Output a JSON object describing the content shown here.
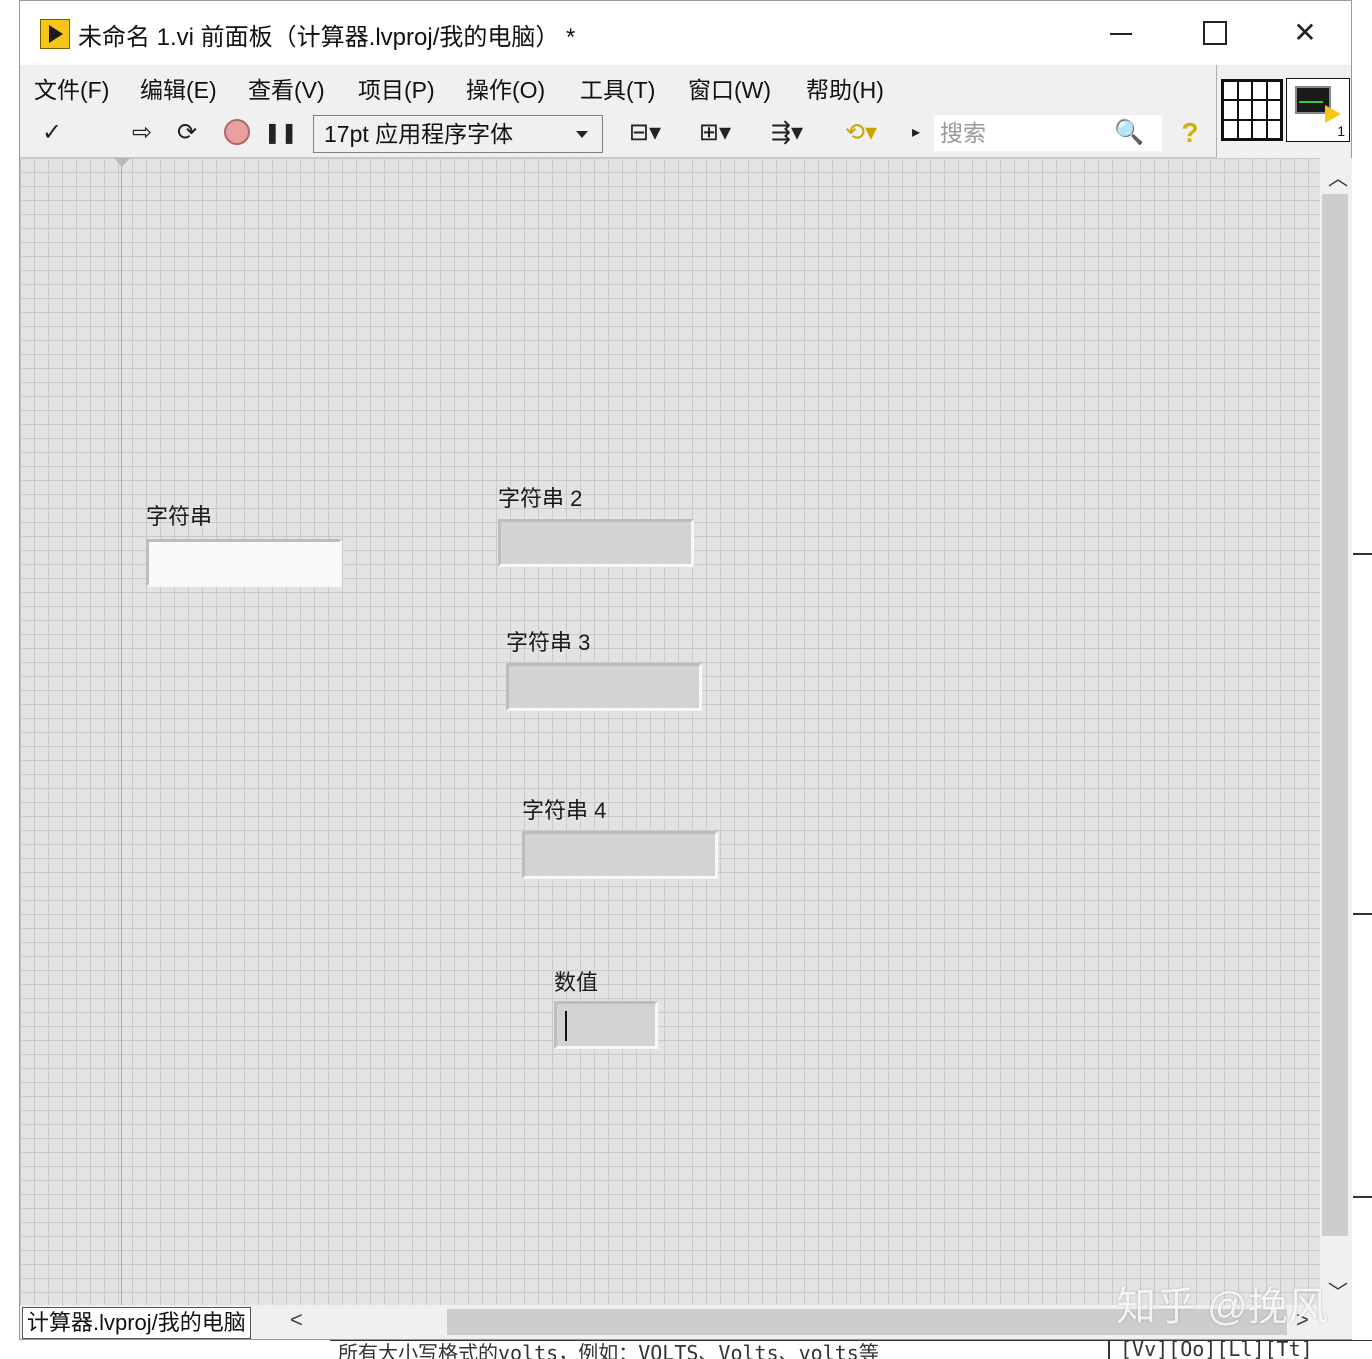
{
  "window": {
    "title": "未命名 1.vi 前面板（计算器.lvproj/我的电脑） *",
    "close_glyph": "✕"
  },
  "menu": {
    "items": [
      "文件(F)",
      "编辑(E)",
      "查看(V)",
      "项目(P)",
      "操作(O)",
      "工具(T)",
      "窗口(W)",
      "帮助(H)"
    ]
  },
  "toolbar": {
    "check_glyph": "✓",
    "run_glyph": "⇨",
    "run_continuous_glyph": "⟳",
    "pause_glyph": "❚❚",
    "font": "17pt 应用程序字体",
    "search_placeholder": "搜索",
    "search_icon_glyph": "🔍",
    "help_glyph": "?",
    "align_glyph": "⊟▾",
    "distribute_glyph": "⊞▾",
    "resize_glyph": "⇶▾",
    "reorder_glyph": "⟲▾",
    "expand_glyph": "▸"
  },
  "front_panel": {
    "controls": [
      {
        "label": "字符串",
        "type": "string-control"
      },
      {
        "label": "字符串 2",
        "type": "string-indicator"
      },
      {
        "label": "字符串 3",
        "type": "string-indicator"
      },
      {
        "label": "字符串 4",
        "type": "string-indicator"
      },
      {
        "label": "数值",
        "type": "numeric-indicator"
      }
    ]
  },
  "vi_icon": {
    "number": "1"
  },
  "scroll": {
    "up_glyph": "︿",
    "down_glyph": "﹀",
    "left_glyph": "<",
    "right_glyph": ">"
  },
  "status": {
    "project": "计算器.lvproj/我的电脑"
  },
  "watermark": "知乎 @挽风",
  "background_text": {
    "bottom": "所有大小写格式的volts，例如：VOLTS、Volts、volts等",
    "bottom_right": "[Vv][Oo][Ll][Tt]"
  }
}
